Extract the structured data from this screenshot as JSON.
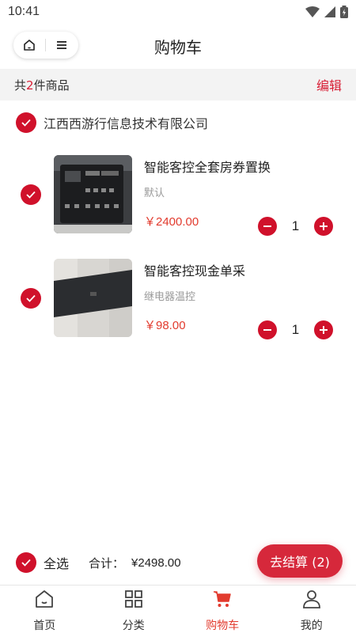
{
  "status_bar": {
    "time": "10:41"
  },
  "nav": {
    "title": "购物车"
  },
  "summary": {
    "prefix": "共",
    "count": "2",
    "suffix": "件商品",
    "edit_label": "编辑"
  },
  "shop": {
    "name": "江西西游行信息技术有限公司",
    "checked": true
  },
  "items": [
    {
      "title": "智能客控全套房券置换",
      "spec": "默认",
      "price": "￥2400.00",
      "quantity": "1",
      "checked": true,
      "thumb_icon": "control-panel-image"
    },
    {
      "title": "智能客控现金单采",
      "spec": "继电器温控",
      "price": "￥98.00",
      "quantity": "1",
      "checked": true,
      "thumb_icon": "relay-strip-image"
    }
  ],
  "footer": {
    "select_all_label": "全选",
    "total_label": "合计：",
    "total_value": "¥2498.00",
    "checkout_label": "去结算 (2)"
  },
  "tabs": [
    {
      "label": "首页",
      "icon": "home-icon",
      "active": false
    },
    {
      "label": "分类",
      "icon": "grid-icon",
      "active": false
    },
    {
      "label": "购物车",
      "icon": "cart-icon",
      "active": true
    },
    {
      "label": "我的",
      "icon": "user-icon",
      "active": false
    }
  ],
  "colors": {
    "accent": "#d0112b",
    "price": "#e23b2e",
    "summary_bg": "#f3f3f3"
  }
}
